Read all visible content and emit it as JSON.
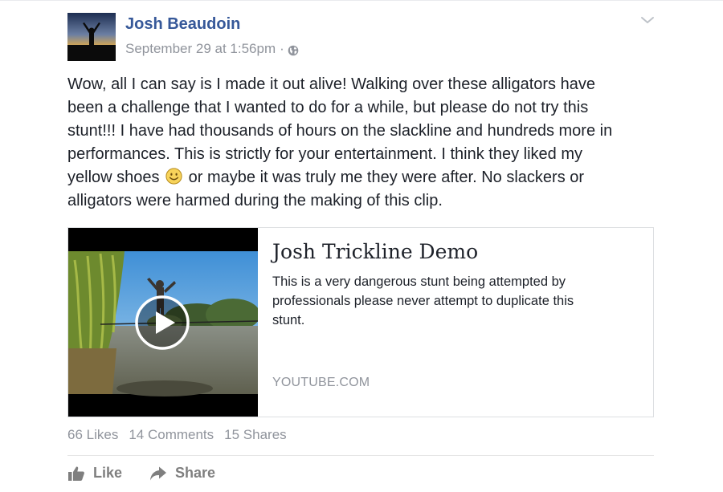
{
  "post": {
    "author": "Josh Beaudoin",
    "timestamp": "September 29 at 1:56pm",
    "separator": "·",
    "privacy_icon": "globe-icon",
    "menu_icon": "chevron-down-icon",
    "text_lines": [
      "Wow, all I can say is I made it out alive! Walking over these alligators have",
      "been a challenge that I wanted to do for a while, but please do not try this",
      "stunt!!! I have had thousands of hours on the slackline and hundreds more in",
      "performances. This is strictly for your entertainment. I think they liked my",
      "or maybe it was truly me they were after. No slackers or",
      "alligators were harmed during the making of this clip."
    ],
    "text_line5_prefix": "yellow shoes",
    "emoji_icon": "smiley-emoji-icon"
  },
  "link_card": {
    "title": "Josh Trickline Demo",
    "description_lines": [
      "This is a very dangerous stunt being attempted by",
      "professionals please never attempt to duplicate this",
      "stunt."
    ],
    "source": "YOUTUBE.COM",
    "play_icon": "play-icon"
  },
  "stats": {
    "likes": "66 Likes",
    "comments": "14 Comments",
    "shares": "15 Shares"
  },
  "actions": {
    "like_label": "Like",
    "share_label": "Share"
  },
  "colors": {
    "author_link": "#365899",
    "meta_gray": "#90949c",
    "body_text": "#1d2129",
    "action_gray": "#7f7f7f"
  }
}
